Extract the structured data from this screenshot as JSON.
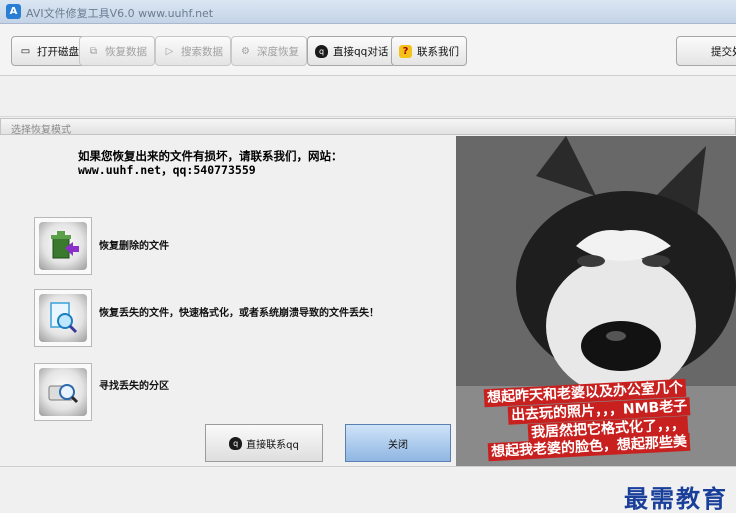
{
  "window": {
    "title": "AVI文件修复工具V6.0 www.uuhf.net"
  },
  "toolbar": {
    "buttons": [
      {
        "label": "打开磁盘",
        "icon": "disk-icon",
        "enabled": true
      },
      {
        "label": "恢复数据",
        "icon": "restore-icon",
        "enabled": false
      },
      {
        "label": "搜索数据",
        "icon": "search-data-icon",
        "enabled": false
      },
      {
        "label": "深度恢复",
        "icon": "deep-restore-icon",
        "enabled": false
      },
      {
        "label": "直接qq对话",
        "icon": "qq-icon",
        "enabled": true
      },
      {
        "label": "联系我们",
        "icon": "question-icon",
        "enabled": true
      },
      {
        "label": "提交处",
        "icon": "submit-icon",
        "enabled": true
      }
    ]
  },
  "panel": {
    "title": "选择恢复模式"
  },
  "notice": {
    "text": "如果您恢复出来的文件有损坏，请联系我们，网站：www.uuhf.net，qq:540773559"
  },
  "options": [
    {
      "label": "恢复删除的文件",
      "icon": "recycle-bin-icon"
    },
    {
      "label": "恢复丢失的文件，快速格式化，或者系统崩溃导致的文件丢失！",
      "icon": "magnifier-document-icon"
    },
    {
      "label": "寻找丢失的分区",
      "icon": "partition-search-icon"
    }
  ],
  "buttons": {
    "contact": "直接联系qq",
    "close": "关闭"
  },
  "meme": {
    "lines": [
      "想起昨天和老婆以及办公室几个",
      "出去玩的照片，，，NMB老子",
      "我居然把它格式化了，，，",
      "想起我老婆的脸色，想起那些美"
    ]
  },
  "watermark": "最需教育",
  "colors": {
    "accent": "#2a7fd4",
    "meme_red": "#c8201e",
    "watermark": "#1a3f9a"
  }
}
